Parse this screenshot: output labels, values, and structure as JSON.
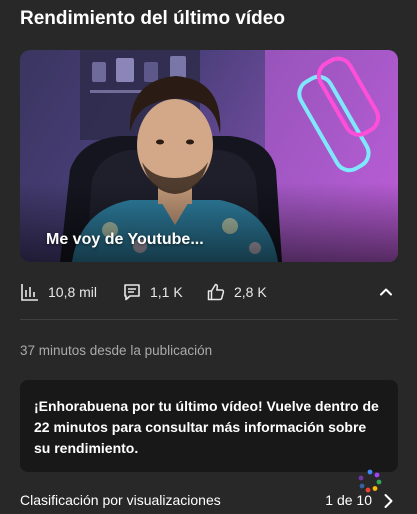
{
  "card": {
    "title": "Rendimiento del último vídeo"
  },
  "video": {
    "thumbnail_title": "Me voy de Youtube..."
  },
  "stats": {
    "views": "10,8 mil",
    "comments": "1,1 K",
    "likes": "2,8 K"
  },
  "published": {
    "text": "37 minutos desde la publicación"
  },
  "notice": {
    "text": "¡Enhorabuena por tu último vídeo! Vuelve dentro de 22 minutos para consultar más información sobre su rendimiento."
  },
  "ranking": {
    "label": "Clasificación por visualizaciones",
    "page": "1 de 10"
  },
  "colors": {
    "background": "#282828",
    "notice_background": "#181818",
    "secondary_text": "#aaaaaa",
    "neon_pink": "#ff4fd8",
    "neon_cyan": "#7fe8ff"
  },
  "icons": {
    "views": "bar-chart-icon",
    "comments": "comment-icon",
    "likes": "thumbs-up-icon",
    "collapse": "chevron-up-icon",
    "next": "chevron-right-icon"
  }
}
